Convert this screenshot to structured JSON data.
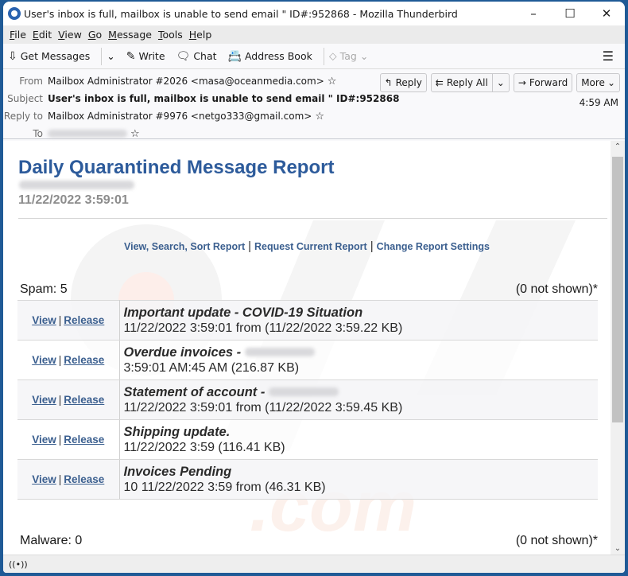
{
  "window": {
    "title": "User's inbox is full, mailbox is unable to send email \" ID#:952868 - Mozilla Thunderbird",
    "controls": {
      "minimize": "–",
      "maximize": "☐",
      "close": "✕"
    }
  },
  "menubar": {
    "items": [
      {
        "key": "F",
        "rest": "ile"
      },
      {
        "key": "E",
        "rest": "dit"
      },
      {
        "key": "V",
        "rest": "iew"
      },
      {
        "key": "G",
        "rest": "o"
      },
      {
        "key": "M",
        "rest": "essage"
      },
      {
        "key": "T",
        "rest": "ools"
      },
      {
        "key": "H",
        "rest": "elp"
      }
    ]
  },
  "toolbar": {
    "get_messages": "Get Messages",
    "write": "Write",
    "chat": "Chat",
    "address_book": "Address Book",
    "tag": "Tag"
  },
  "header": {
    "labels": {
      "from": "From",
      "subject": "Subject",
      "reply_to": "Reply to",
      "to": "To"
    },
    "from": "Mailbox Administrator #2026 <masa@oceanmedia.com>",
    "subject": "User's inbox is full, mailbox is unable to send email \" ID#:952868",
    "reply_to": "Mailbox Administrator #9976 <netgo333@gmail.com>",
    "time": "4:59 AM",
    "actions": {
      "reply": "Reply",
      "reply_all": "Reply All",
      "forward": "Forward",
      "more": "More"
    }
  },
  "report": {
    "title": "Daily Quarantined Message Report",
    "date": "11/22/2022 3:59:01",
    "links": [
      "View, Search, Sort Report",
      "Request Current Report",
      "Change Report Settings"
    ],
    "spam": {
      "label": "Spam: 5",
      "not_shown": "(0 not shown)*"
    },
    "malware": {
      "label": "Malware: 0",
      "not_shown": "(0 not shown)*"
    },
    "action_labels": {
      "view": "View",
      "release": "Release",
      "separator": "|"
    },
    "messages": [
      {
        "subject": "Important update - COVID-19 Situation",
        "subject_blurred": false,
        "detail": "11/22/2022 3:59:01 from (11/22/2022 3:59.22 KB)"
      },
      {
        "subject": "Overdue invoices -",
        "subject_blurred": true,
        "detail": "3:59:01 AM:45 AM (216.87 KB)"
      },
      {
        "subject": "Statement of account -",
        "subject_blurred": true,
        "detail": "11/22/2022 3:59:01 from (11/22/2022 3:59.45 KB)"
      },
      {
        "subject": "Shipping update.",
        "subject_blurred": false,
        "detail": "11/22/2022 3:59 (116.41 KB)"
      },
      {
        "subject": "Invoices Pending",
        "subject_blurred": false,
        "detail": "10 11/22/2022 3:59 from (46.31 KB)"
      }
    ]
  },
  "colors": {
    "accent": "#2d5b9b",
    "link": "#3b5f8f",
    "frame": "#1f5a96"
  }
}
